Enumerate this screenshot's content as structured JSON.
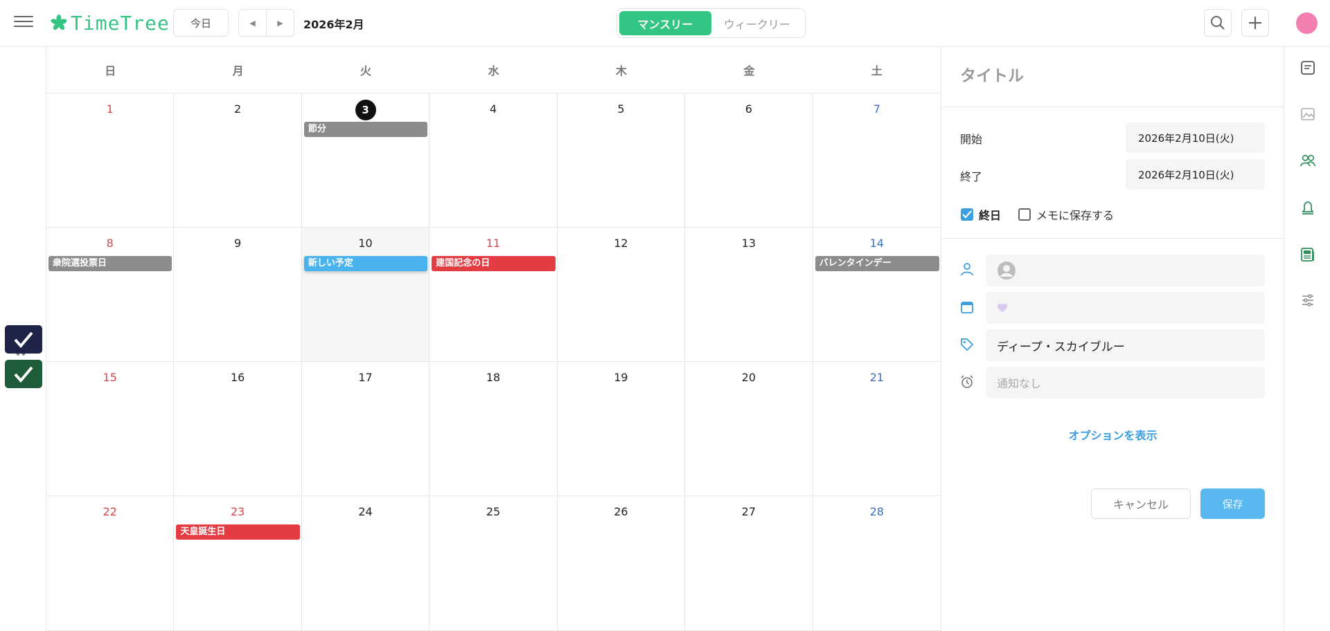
{
  "app": {
    "logo_text": "TimeTree"
  },
  "header": {
    "today_label": "今日",
    "month_label": "2026年2月",
    "view_monthly": "マンスリー",
    "view_weekly": "ウィークリー"
  },
  "calendar": {
    "weekdays": [
      "日",
      "月",
      "火",
      "水",
      "木",
      "金",
      "土"
    ],
    "days": [
      {
        "n": "1",
        "type": "sun"
      },
      {
        "n": "2"
      },
      {
        "n": "3",
        "type": "today",
        "event": {
          "label": "節分",
          "color": "gray"
        }
      },
      {
        "n": "4"
      },
      {
        "n": "5"
      },
      {
        "n": "6"
      },
      {
        "n": "7",
        "type": "sat"
      },
      {
        "n": "8",
        "type": "sun",
        "event": {
          "label": "衆院選投票日",
          "color": "gray"
        }
      },
      {
        "n": "9"
      },
      {
        "n": "10",
        "selected": true,
        "event": {
          "label": "新しい予定",
          "color": "blue"
        }
      },
      {
        "n": "11",
        "type": "sun",
        "event": {
          "label": "建国記念の日",
          "color": "red"
        }
      },
      {
        "n": "12"
      },
      {
        "n": "13"
      },
      {
        "n": "14",
        "type": "sat",
        "event": {
          "label": "バレンタインデー",
          "color": "gray"
        }
      },
      {
        "n": "15",
        "type": "sun"
      },
      {
        "n": "16"
      },
      {
        "n": "17"
      },
      {
        "n": "18"
      },
      {
        "n": "19"
      },
      {
        "n": "20"
      },
      {
        "n": "21",
        "type": "sat"
      },
      {
        "n": "22",
        "type": "sun"
      },
      {
        "n": "23",
        "type": "sun",
        "event": {
          "label": "天皇誕生日",
          "color": "red"
        }
      },
      {
        "n": "24"
      },
      {
        "n": "25"
      },
      {
        "n": "26"
      },
      {
        "n": "27"
      },
      {
        "n": "28",
        "type": "sat"
      }
    ]
  },
  "panel": {
    "title_placeholder": "タイトル",
    "start_label": "開始",
    "start_value": "2026年2月10日(火)",
    "end_label": "終了",
    "end_value": "2026年2月10日(火)",
    "allday_label": "終日",
    "allday_checked": true,
    "memo_label": "メモに保存する",
    "memo_checked": false,
    "label_value": "ディープ・スカイブルー",
    "alarm_value": "通知なし",
    "show_options": "オプションを表示",
    "cancel_label": "キャンセル",
    "save_label": "保存"
  },
  "colors": {
    "accent": "#33c683",
    "today": "#111111",
    "sunday": "#d44a4a",
    "saturday": "#3a6fc4",
    "event_gray": "#8c8c8c",
    "event_red": "#e33c42",
    "event_blue": "#4ab3ee",
    "avatar": "#f27fb0"
  }
}
